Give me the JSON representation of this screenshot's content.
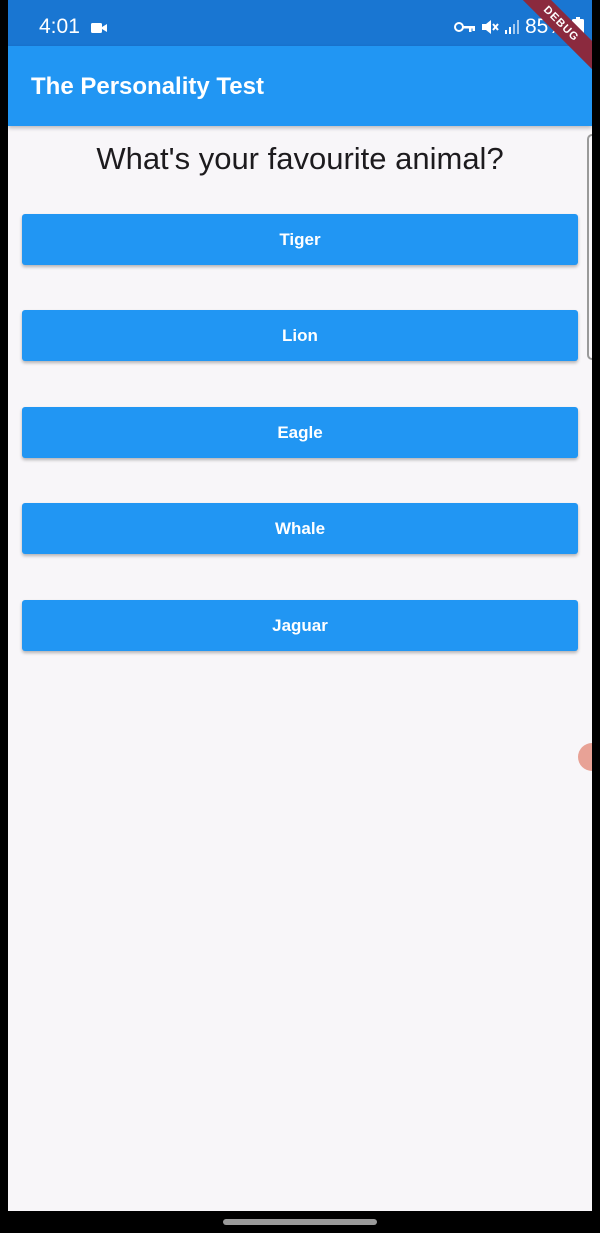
{
  "status_bar": {
    "time": "4:01",
    "battery_percent": "85%",
    "icons": [
      "video-camera-icon",
      "vpn-key-icon",
      "mute-icon",
      "signal-icon",
      "battery-icon"
    ],
    "background": "#1976d2"
  },
  "app_bar": {
    "title": "The Personality Test",
    "background": "#2196f3"
  },
  "debug_banner": {
    "label": "DEBUG",
    "color": "#8b2a3e"
  },
  "quiz": {
    "question": "What's your favourite animal?",
    "answers": [
      "Tiger",
      "Lion",
      "Eagle",
      "Whale",
      "Jaguar"
    ],
    "button_color": "#2196f3"
  }
}
